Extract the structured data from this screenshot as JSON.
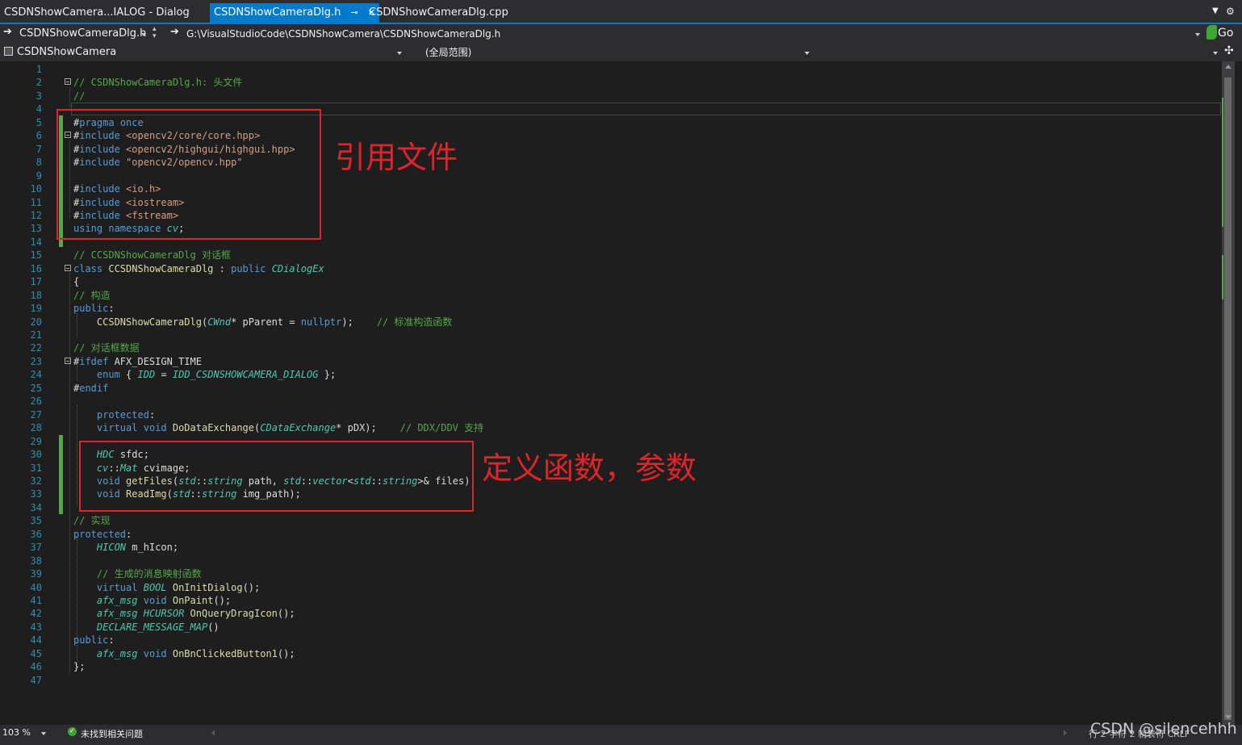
{
  "tabs": [
    {
      "label": "CSDNShowCamera...IALOG - Dialog"
    },
    {
      "label": "CSDNShowCameraDlg.h"
    },
    {
      "label": "CSDNShowCameraDlg.cpp"
    }
  ],
  "nav": {
    "file_combo": "CSDNShowCameraDlg.h",
    "path": "G:\\VisualStudioCode\\CSDNShowCamera\\CSDNShowCameraDlg.h",
    "go_label": "Go",
    "project_combo": "CSDNShowCamera",
    "scope_combo": "(全局范围)",
    "member_combo": ""
  },
  "code_lines": [
    "",
    "// CSDNShowCameraDlg.h: 头文件",
    "//",
    "",
    "#pragma once",
    "#include <opencv2/core/core.hpp>",
    "#include <opencv2/highgui/highgui.hpp>",
    "#include \"opencv2/opencv.hpp\"",
    "",
    "#include <io.h>",
    "#include <iostream>",
    "#include <fstream>",
    "using namespace cv;",
    "",
    "// CCSDNShowCameraDlg 对话框",
    "class CCSDNShowCameraDlg : public CDialogEx",
    "{",
    "// 构造",
    "public:",
    "    CCSDNShowCameraDlg(CWnd* pParent = nullptr);    // 标准构造函数",
    "",
    "// 对话框数据",
    "#ifdef AFX_DESIGN_TIME",
    "    enum { IDD = IDD_CSDNSHOWCAMERA_DIALOG };",
    "#endif",
    "",
    "    protected:",
    "    virtual void DoDataExchange(CDataExchange* pDX);    // DDX/DDV 支持",
    "",
    "    HDC sfdc;",
    "    cv::Mat cvimage;",
    "    void getFiles(std::string path, std::vector<std::string>& files);",
    "    void ReadImg(std::string img_path);",
    "",
    "// 实现",
    "protected:",
    "    HICON m_hIcon;",
    "",
    "    // 生成的消息映射函数",
    "    virtual BOOL OnInitDialog();",
    "    afx_msg void OnPaint();",
    "    afx_msg HCURSOR OnQueryDragIcon();",
    "    DECLARE_MESSAGE_MAP()",
    "public:",
    "    afx_msg void OnBnClickedButton1();",
    "};",
    ""
  ],
  "annotations": {
    "include_note": "引用文件",
    "define_note": "定义函数，参数"
  },
  "status": {
    "zoom": "103 %",
    "issues": "未找到相关问题",
    "right_info": "行 2   字符 2   制表符   CRLF"
  },
  "watermark": "CSDN @silencehhh",
  "colors": {
    "accent": "#007acc",
    "comment": "#57a64a",
    "keyword": "#569cd6",
    "type": "#4ec9b0",
    "string": "#d69d85",
    "annotation_red": "#e0242c"
  }
}
